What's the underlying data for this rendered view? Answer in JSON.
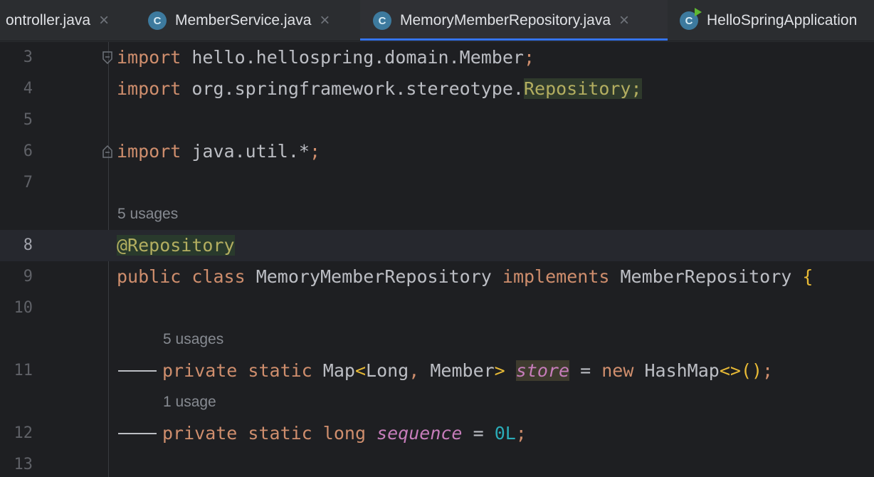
{
  "tabs": [
    {
      "label": "ontroller.java",
      "active": false,
      "closable": true,
      "icon": null
    },
    {
      "label": "MemberService.java",
      "active": false,
      "closable": true,
      "icon": "C"
    },
    {
      "label": "MemoryMemberRepository.java",
      "active": true,
      "closable": true,
      "icon": "C"
    },
    {
      "label": "HelloSpringApplication",
      "active": false,
      "closable": false,
      "icon": "C"
    }
  ],
  "close_glyph": "×",
  "editor": {
    "line_numbers": [
      "3",
      "4",
      "5",
      "6",
      "7",
      "8",
      "9",
      "10",
      "11",
      "12",
      "13"
    ],
    "current_line": "8",
    "inlays": {
      "class_usages": "5 usages",
      "store_usages": "5 usages",
      "sequence_usages": "1 usage"
    },
    "tokens": {
      "import": "import",
      "pkg_member": "hello.hellospring.domain.Member",
      "pkg_stereotype": "org.springframework.stereotype.",
      "repository": "Repository",
      "semicolon": ";",
      "pkg_util": "java.util.*",
      "annotation": "@Repository",
      "public": "public",
      "class": "class",
      "class_name": "MemoryMemberRepository",
      "implements": "implements",
      "interface_name": "MemberRepository",
      "open_brace": "{",
      "private": "private",
      "static": "static",
      "map_type": "Map",
      "lt": "<",
      "long_type": "Long",
      "comma": ",",
      "member_type": "Member",
      "gt": ">",
      "store": "store",
      "equals": "=",
      "new": "new",
      "hashmap": "HashMap",
      "diamond": "<>",
      "parens": "()",
      "long_kw": "long",
      "sequence": "sequence",
      "zero_l": "0L"
    }
  },
  "colors": {
    "keyword": "#cf8e6d",
    "annotation": "#b3ae60",
    "number": "#2aacb8",
    "field": "#c77dbb",
    "plain": "#bcbec4",
    "accent": "#3574f0"
  }
}
